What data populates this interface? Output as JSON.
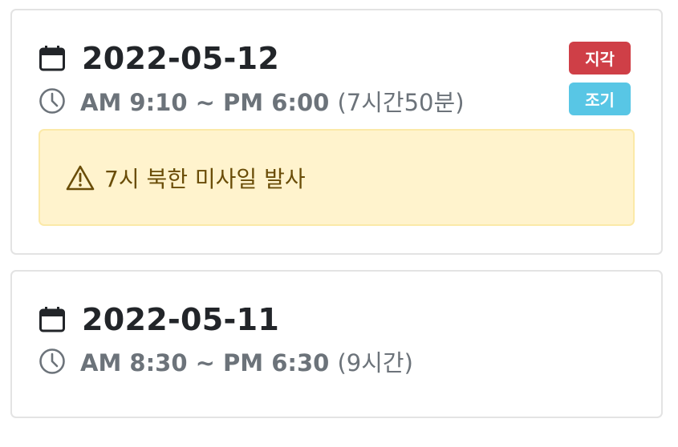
{
  "records": [
    {
      "date": "2022-05-12",
      "time_range": "AM 9:10 ~ PM 6:00",
      "duration": "(7시간50분)",
      "badges": [
        {
          "label": "지각",
          "color": "#cf3f47"
        },
        {
          "label": "조기",
          "color": "#58c6e5"
        }
      ],
      "note": "7시 북한 미사일 발사"
    },
    {
      "date": "2022-05-11",
      "time_range": "AM 8:30 ~ PM 6:30",
      "duration": "(9시간)"
    }
  ],
  "icons": {
    "date": "calendar-icon",
    "time": "clock-icon",
    "note": "warning-triangle-icon"
  },
  "colors": {
    "late_badge": "#cf3f47",
    "early_badge": "#58c6e5",
    "note_background": "#fff3cd",
    "note_text": "#6a4d08"
  }
}
